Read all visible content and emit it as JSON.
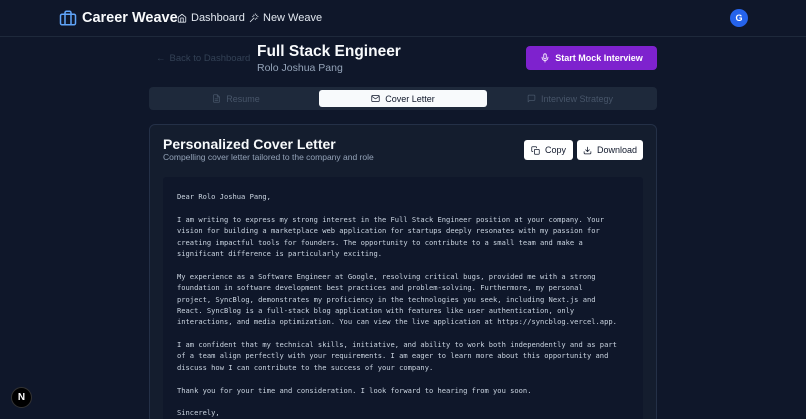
{
  "nav": {
    "brand": "Career Weave",
    "links": [
      {
        "label": "Dashboard",
        "icon": "home-icon"
      },
      {
        "label": "New Weave",
        "icon": "wand-icon"
      }
    ],
    "avatar_initial": "G"
  },
  "header": {
    "back_label": "Back to Dashboard",
    "title": "Full Stack Engineer",
    "subtitle": "Rolo Joshua Pang",
    "mock_interview_label": "Start Mock Interview"
  },
  "tabs": [
    {
      "label": "Resume",
      "icon": "document-icon",
      "active": false
    },
    {
      "label": "Cover Letter",
      "icon": "mail-icon",
      "active": true
    },
    {
      "label": "Interview Strategy",
      "icon": "chat-icon",
      "active": false
    }
  ],
  "card": {
    "title": "Personalized Cover Letter",
    "subtitle": "Compelling cover letter tailored to the company and role",
    "copy_label": "Copy",
    "download_label": "Download",
    "letter_lines": [
      "Dear Rolo Joshua Pang,",
      "",
      "I am writing to express my strong interest in the Full Stack Engineer position at your company. Your",
      "vision for building a marketplace web application for startups deeply resonates with my passion for",
      "creating impactful tools for founders. The opportunity to contribute to a small team and make a",
      "significant difference is particularly exciting.",
      "",
      "My experience as a Software Engineer at Google, resolving critical bugs, provided me with a strong",
      "foundation in software development best practices and problem-solving. Furthermore, my personal",
      "project, SyncBlog, demonstrates my proficiency in the technologies you seek, including Next.js and",
      "React. SyncBlog is a full-stack blog application with features like user authentication, only",
      "interactions, and media optimization. You can view the live application at https://syncblog.vercel.app.",
      "",
      "I am confident that my technical skills, initiative, and ability to work both independently and as part",
      "of a team align perfectly with your requirements. I am eager to learn more about this opportunity and",
      "discuss how I can contribute to the success of your company.",
      "",
      "Thank you for your time and consideration. I look forward to hearing from you soon.",
      "",
      "Sincerely,"
    ]
  },
  "dev_badge": "N",
  "colors": {
    "background": "#0f172a",
    "accent_purple": "#7e22ce",
    "avatar_blue": "#2563eb"
  }
}
